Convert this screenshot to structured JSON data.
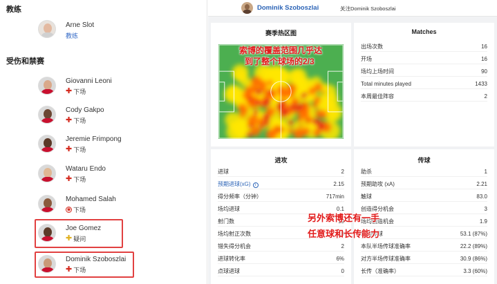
{
  "left": {
    "coach_section": "教练",
    "coach": {
      "name": "Arne Slot",
      "role": "教练"
    },
    "injury_section": "受伤和禁赛",
    "players": [
      {
        "name": "Giovanni Leoni",
        "status": "下场",
        "status_type": "injury"
      },
      {
        "name": "Cody Gakpo",
        "status": "下场",
        "status_type": "injury"
      },
      {
        "name": "Jeremie Frimpong",
        "status": "下场",
        "status_type": "injury"
      },
      {
        "name": "Wataru Endo",
        "status": "下场",
        "status_type": "injury"
      },
      {
        "name": "Mohamed Salah",
        "status": "下场",
        "status_type": "international"
      },
      {
        "name": "Joe Gomez",
        "status": "疑问",
        "status_type": "doubtful"
      },
      {
        "name": "Dominik Szoboszlai",
        "status": "下场",
        "status_type": "injury"
      }
    ]
  },
  "topbar": {
    "name": "Dominik Szoboszlai",
    "follow": "关注Dominik Szoboszlai"
  },
  "heatmap": {
    "title": "赛季热区图"
  },
  "matches": {
    "title": "Matches",
    "rows": [
      {
        "label": "出场次数",
        "value": "16"
      },
      {
        "label": "开场",
        "value": "16"
      },
      {
        "label": "场均上场时间",
        "value": "90"
      },
      {
        "label": "Total minutes played",
        "value": "1433"
      },
      {
        "label": "本周最佳阵容",
        "value": "2"
      }
    ]
  },
  "attack": {
    "title": "进攻",
    "rows": [
      {
        "label": "进球",
        "value": "2"
      },
      {
        "label": "预期进球(xG)",
        "value": "2.15"
      },
      {
        "label": "得分频率（分钟）",
        "value": "717min"
      },
      {
        "label": "场均进球",
        "value": "0.1"
      },
      {
        "label": "射门数",
        "value": "19"
      },
      {
        "label": "场均射正次数",
        "value": "0.8"
      },
      {
        "label": "错失得分机会",
        "value": "2"
      },
      {
        "label": "进球转化率",
        "value": "6%"
      },
      {
        "label": "点球进球",
        "value": "0"
      }
    ]
  },
  "passing": {
    "title": "传球",
    "rows": [
      {
        "label": "助杀",
        "value": "1"
      },
      {
        "label": "预期助攻 (xA)",
        "value": "2.21"
      },
      {
        "label": "触球",
        "value": "83.0"
      },
      {
        "label": "创造得分机会",
        "value": "3"
      },
      {
        "label": "场均创造机会",
        "value": "1.9"
      },
      {
        "label": "场均传球",
        "value": "53.1 (87%)"
      },
      {
        "label": "本队半场传球准确率",
        "value": "22.2 (89%)"
      },
      {
        "label": "对方半场传球准确率",
        "value": "30.9 (86%)"
      },
      {
        "label": "长传（准确率）",
        "value": "3.3 (60%)"
      }
    ]
  },
  "annotations": {
    "heat_line1": "索博的覆盖范围几乎达",
    "heat_line2": "到了整个球场的2/3",
    "pass_line1": "另外索博还有一手",
    "pass_line2": "任意球和长传能力"
  },
  "colors": {
    "accent_blue": "#2b63b6",
    "injury_red": "#d42a1e",
    "doubtful_yellow": "#e0b020",
    "highlight_red": "#e14040",
    "annotation_red": "#e21b1b",
    "pitch_green": "#4caf50"
  }
}
